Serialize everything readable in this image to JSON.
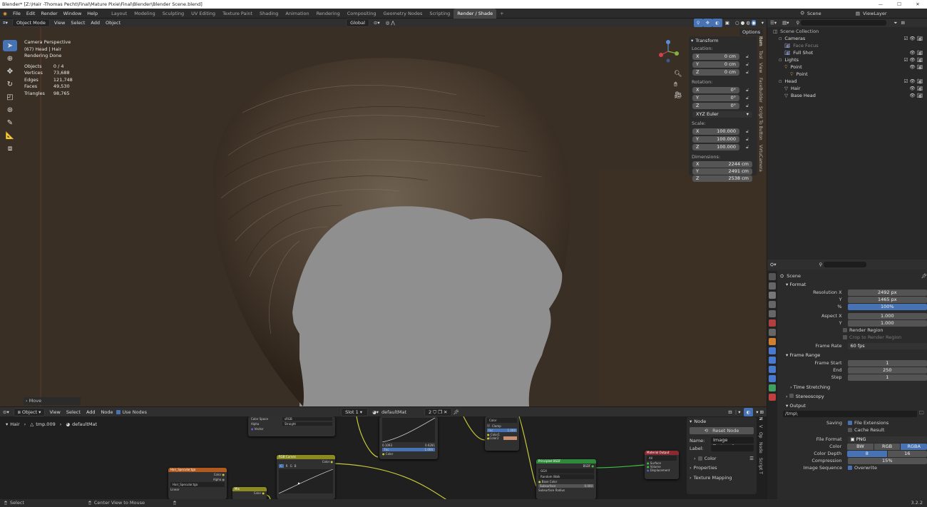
{
  "titlebar": {
    "title": "Blender* [Z:\\Hair  -Thomas Pecht\\Final\\Mature Pixie\\Final\\Blender\\Blender Scene.blend]",
    "minimize": "—",
    "maximize": "☐",
    "close": "✕"
  },
  "menu": [
    "File",
    "Edit",
    "Render",
    "Window",
    "Help"
  ],
  "workspaces": [
    "Layout",
    "Modeling",
    "Sculpting",
    "UV Editing",
    "Texture Paint",
    "Shading",
    "Animation",
    "Rendering",
    "Compositing",
    "Geometry Nodes",
    "Scripting",
    "Render / Shade"
  ],
  "active_workspace": "Render / Shade",
  "add_workspace": "+",
  "topright": {
    "scene": "Scene",
    "viewlayer": "ViewLayer"
  },
  "viewport_header": {
    "mode": "Object Mode",
    "menus": [
      "View",
      "Select",
      "Add",
      "Object"
    ],
    "orientation": "Global",
    "options": "Options"
  },
  "overlay": {
    "line1": "Camera Perspective",
    "line2": "(67) Head  | Hair",
    "line3": "Rendering Done",
    "stats": [
      [
        "Objects",
        "0 / 4"
      ],
      [
        "Vertices",
        "73,688"
      ],
      [
        "Edges",
        "121,748"
      ],
      [
        "Faces",
        "49,530"
      ],
      [
        "Triangles",
        "98,765"
      ]
    ]
  },
  "move_panel": "Move",
  "npanel": {
    "title": "Transform",
    "location_label": "Location:",
    "location": [
      [
        "X",
        "0 cm"
      ],
      [
        "Y",
        "0 cm"
      ],
      [
        "Z",
        "0 cm"
      ]
    ],
    "rotation_label": "Rotation:",
    "rotation": [
      [
        "X",
        "0°"
      ],
      [
        "Y",
        "0°"
      ],
      [
        "Z",
        "0°"
      ]
    ],
    "rotation_mode": "XYZ Euler",
    "scale_label": "Scale:",
    "scale": [
      [
        "X",
        "100.000"
      ],
      [
        "Y",
        "100.000"
      ],
      [
        "Z",
        "100.000"
      ]
    ],
    "dimensions_label": "Dimensions:",
    "dimensions": [
      [
        "X",
        "2244 cm"
      ],
      [
        "Y",
        "2491 cm"
      ],
      [
        "Z",
        "2538 cm"
      ]
    ],
    "tabs": [
      "Item",
      "Tool",
      "View",
      "FaceBuilder",
      "Script To Button",
      "VirtuCamera"
    ]
  },
  "outliner": {
    "items": [
      {
        "label": "Scene Collection",
        "indent": 0,
        "color": "#bbbbbb"
      },
      {
        "label": "Cameras",
        "indent": 1,
        "color": "#dddddd"
      },
      {
        "label": "Face Focus",
        "indent": 2,
        "color": "#888888"
      },
      {
        "label": "Full Shot",
        "indent": 2,
        "color": "#dddddd"
      },
      {
        "label": "Lights",
        "indent": 1,
        "color": "#dddddd"
      },
      {
        "label": "Point",
        "indent": 2,
        "color": "#dddddd"
      },
      {
        "label": "Point",
        "indent": 3,
        "color": "#dddddd"
      },
      {
        "label": "Head",
        "indent": 1,
        "color": "#dddddd"
      },
      {
        "label": "Hair",
        "indent": 2,
        "color": "#dddddd"
      },
      {
        "label": "Base Head",
        "indent": 2,
        "color": "#dddddd"
      }
    ]
  },
  "properties": {
    "scene": "Scene",
    "format_section": "Format",
    "resolution_x_label": "Resolution X",
    "resolution_x": "2492 px",
    "y_label": "Y",
    "resolution_y": "1465 px",
    "percent_label": "%",
    "percent": "100%",
    "aspect_x_label": "Aspect X",
    "aspect_x": "1.000",
    "aspect_y_label": "Y",
    "aspect_y": "1.000",
    "render_region": "Render Region",
    "crop": "Crop to Render Region",
    "frame_rate_label": "Frame Rate",
    "frame_rate": "60 fps",
    "frame_range_section": "Frame Range",
    "frame_start_label": "Frame Start",
    "frame_start": "1",
    "end_label": "End",
    "end": "250",
    "step_label": "Step",
    "step": "1",
    "time_stretching": "Time Stretching",
    "stereoscopy": "Stereoscopy",
    "output_section": "Output",
    "output_path": "/tmp\\",
    "saving_label": "Saving",
    "file_extensions": "File Extensions",
    "cache_result": "Cache Result",
    "file_format_label": "File Format",
    "file_format": "PNG",
    "color_label": "Color",
    "color_options": [
      "BW",
      "RGB",
      "RGBA"
    ],
    "color_active": "RGBA",
    "color_depth_label": "Color Depth",
    "color_depth": [
      "8",
      "16"
    ],
    "compression_label": "Compression",
    "compression": "15%",
    "image_sequence_label": "Image Sequence",
    "overwrite": "Overwrite"
  },
  "node_header": {
    "mode": "Object",
    "menus": [
      "View",
      "Select",
      "Add",
      "Node"
    ],
    "use_nodes": "Use Nodes",
    "slot": "Slot 1",
    "material": "defaultMat",
    "users": "2"
  },
  "node_breadcrumb": {
    "object": "Hair",
    "mesh": "tmp.009",
    "material": "defaultMat"
  },
  "node_panel": {
    "title": "Node",
    "reset": "Reset Node",
    "name_label": "Name:",
    "name": "Image Texture.0...",
    "label_label": "Label:",
    "color": "Color",
    "properties": "Properties",
    "texture_mapping": "Texture Mapping"
  },
  "nodes": {
    "image_tex": {
      "title": "Color Space",
      "cs": "sRGB",
      "alpha": "Alpha",
      "alpha_val": "Straight",
      "vector": "Vector"
    },
    "curve": {
      "fac_left": "0.1093",
      "fac_right": "0.6281",
      "fac": "Fac",
      "fac_val": "1.000",
      "color": "Color"
    },
    "mix": {
      "title": "Color",
      "clamp": "Clamp",
      "fac": "Fac",
      "fac_val": "1.000",
      "c1": "Color1",
      "c2": "Color2"
    },
    "spec": {
      "title": "Hair_Specular.tga",
      "color": "Color",
      "alpha": "Alpha",
      "linear": "Linear",
      "img": "Hair_Specular.tga"
    },
    "rgb": {
      "title": "RGB Curves",
      "color": "Color",
      "c": "C",
      "r": "R",
      "g": "G",
      "b": "B"
    },
    "mix2": {
      "title": "Mix",
      "color": "Color"
    },
    "bsdf": {
      "title": "Principled BSDF",
      "bsdf": "BSDF",
      "ggx": "GGX",
      "rw": "Random Walk",
      "base": "Base Color",
      "subsurface": "Subsurface",
      "sub_val": "0.000",
      "sub_radius": "Subsurface Radius"
    },
    "out": {
      "title": "Material Output",
      "all": "All",
      "surface": "Surface",
      "volume": "Volume",
      "disp": "Displacement"
    }
  },
  "statusbar": {
    "select": "Select",
    "center": "Center View to Mouse",
    "version": "3.2.2"
  }
}
